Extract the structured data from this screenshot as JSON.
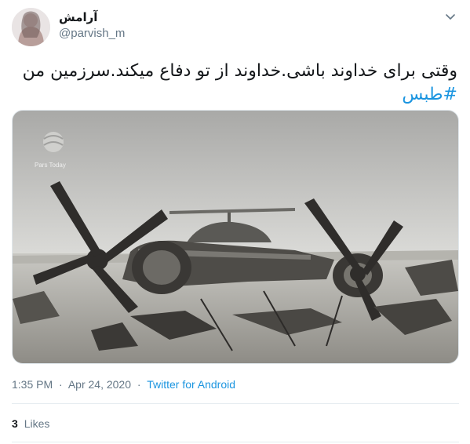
{
  "tweet": {
    "author": {
      "display_name": "آرامش",
      "handle": "@parvish_m"
    },
    "text": "وقتی برای خداوند باشی.خداوند از تو دفاع میکند.سرزمین من",
    "hashtag": "#طبس",
    "media": {
      "watermark": "Pars Today",
      "icon": "pars-today-logo"
    },
    "time": "1:35 PM",
    "date": "Apr 24, 2020",
    "separator": "·",
    "source": "Twitter for Android",
    "likes_count": "3",
    "likes_label": "Likes"
  },
  "icons": {
    "menu": "chevron-down-icon"
  },
  "colors": {
    "link": "#1b95e0",
    "text": "#14171a",
    "secondary": "#657786",
    "divider": "#e6ecf0"
  }
}
